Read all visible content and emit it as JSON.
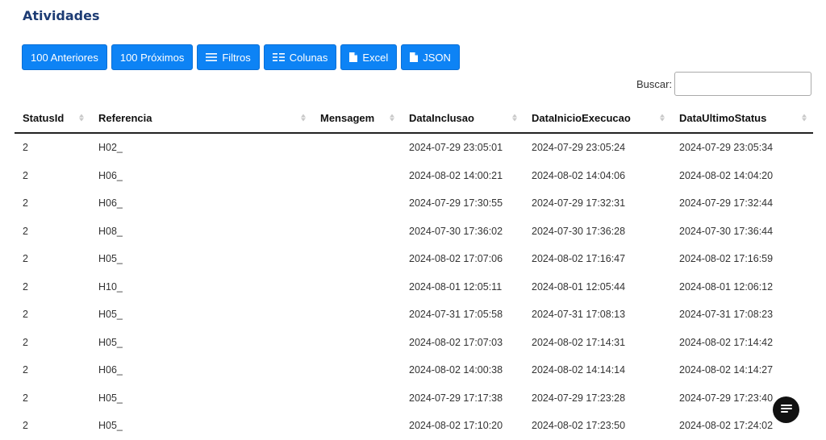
{
  "page": {
    "title": "Atividades"
  },
  "toolbar": {
    "prev": "100 Anteriores",
    "next": "100 Próximos",
    "filters": "Filtros",
    "columns": "Colunas",
    "excel": "Excel",
    "json": "JSON"
  },
  "search": {
    "label": "Buscar:",
    "value": ""
  },
  "table": {
    "headers": [
      "StatusId",
      "Referencia",
      "Mensagem",
      "DataInclusao",
      "DataInicioExecucao",
      "DataUltimoStatus"
    ],
    "rows": [
      [
        "2",
        "H02_",
        "",
        "2024-07-29 23:05:01",
        "2024-07-29 23:05:24",
        "2024-07-29 23:05:34"
      ],
      [
        "2",
        "H06_",
        "",
        "2024-08-02 14:00:21",
        "2024-08-02 14:04:06",
        "2024-08-02 14:04:20"
      ],
      [
        "2",
        "H06_",
        "",
        "2024-07-29 17:30:55",
        "2024-07-29 17:32:31",
        "2024-07-29 17:32:44"
      ],
      [
        "2",
        "H08_",
        "",
        "2024-07-30 17:36:02",
        "2024-07-30 17:36:28",
        "2024-07-30 17:36:44"
      ],
      [
        "2",
        "H05_",
        "",
        "2024-08-02 17:07:06",
        "2024-08-02 17:16:47",
        "2024-08-02 17:16:59"
      ],
      [
        "2",
        "H10_",
        "",
        "2024-08-01 12:05:11",
        "2024-08-01 12:05:44",
        "2024-08-01 12:06:12"
      ],
      [
        "2",
        "H05_",
        "",
        "2024-07-31 17:05:58",
        "2024-07-31 17:08:13",
        "2024-07-31 17:08:23"
      ],
      [
        "2",
        "H05_",
        "",
        "2024-08-02 17:07:03",
        "2024-08-02 17:14:31",
        "2024-08-02 17:14:42"
      ],
      [
        "2",
        "H06_",
        "",
        "2024-08-02 14:00:38",
        "2024-08-02 14:14:14",
        "2024-08-02 14:14:27"
      ],
      [
        "2",
        "H05_",
        "",
        "2024-07-29 17:17:38",
        "2024-07-29 17:23:28",
        "2024-07-29 17:23:40"
      ],
      [
        "2",
        "H05_",
        "",
        "2024-08-02 17:10:20",
        "2024-08-02 17:23:50",
        "2024-08-02 17:24:02"
      ]
    ]
  },
  "colors": {
    "accent": "#0d83f5",
    "title": "#1d3c74"
  },
  "icons": {
    "filters": "list-icon",
    "columns": "columns-icon",
    "excel": "file-icon",
    "json": "file-icon",
    "chat": "chat-icon"
  }
}
